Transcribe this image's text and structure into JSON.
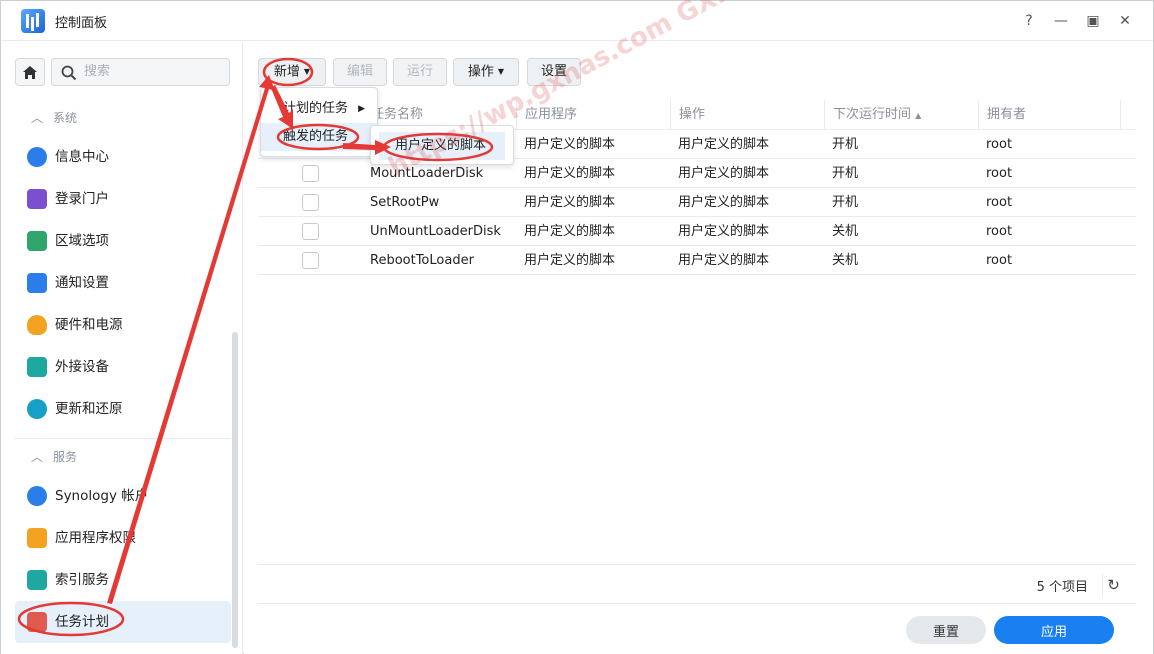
{
  "window": {
    "title": "控制面板"
  },
  "controls": {
    "help": "?",
    "minimize": "—",
    "maximize": "▣",
    "close": "✕"
  },
  "search": {
    "placeholder": "搜索"
  },
  "sidebar": {
    "groups": [
      {
        "label": "系统",
        "items": [
          "信息中心",
          "登录门户",
          "区域选项",
          "通知设置",
          "硬件和电源",
          "外接设备",
          "更新和还原"
        ]
      },
      {
        "label": "服务",
        "items": [
          "Synology 帐户",
          "应用程序权限",
          "索引服务",
          "任务计划"
        ]
      }
    ],
    "active": "任务计划"
  },
  "toolbar": {
    "create": "新增",
    "edit": "编辑",
    "run": "运行",
    "action": "操作",
    "settings": "设置"
  },
  "grid": {
    "columns": [
      "任务名称",
      "应用程序",
      "操作",
      "下次运行时间",
      "拥有者"
    ],
    "sort_indicator": "▲",
    "rows": [
      {
        "name": "",
        "app": "用户定义的脚本",
        "action": "用户定义的脚本",
        "next": "开机",
        "owner": "root"
      },
      {
        "name": "MountLoaderDisk",
        "app": "用户定义的脚本",
        "action": "用户定义的脚本",
        "next": "开机",
        "owner": "root"
      },
      {
        "name": "SetRootPw",
        "app": "用户定义的脚本",
        "action": "用户定义的脚本",
        "next": "开机",
        "owner": "root"
      },
      {
        "name": "UnMountLoaderDisk",
        "app": "用户定义的脚本",
        "action": "用户定义的脚本",
        "next": "关机",
        "owner": "root"
      },
      {
        "name": "RebootToLoader",
        "app": "用户定义的脚本",
        "action": "用户定义的脚本",
        "next": "关机",
        "owner": "root"
      }
    ],
    "count": "5 个项目"
  },
  "menu": {
    "items": [
      "计划的任务",
      "触发的任务"
    ],
    "submenu": [
      "用户定义的脚本"
    ]
  },
  "footer": {
    "reset": "重置",
    "apply": "应用"
  },
  "watermark": "https://wp.gxnas.com  GXNAS博客",
  "colors": {
    "accent": "#1a7ff0",
    "annotation": "#e53935",
    "active_bg": "#e5f0fb"
  }
}
